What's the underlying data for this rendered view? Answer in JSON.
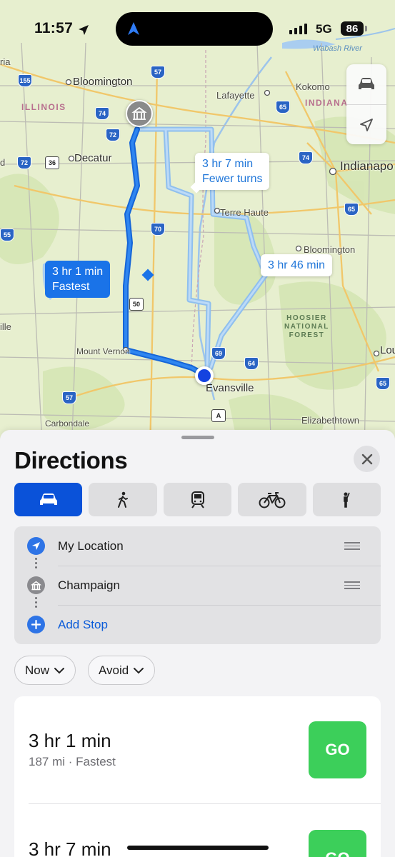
{
  "status_bar": {
    "time": "11:57",
    "network": "5G",
    "battery": "86"
  },
  "map": {
    "cities": [
      "Bloomington",
      "Lafayette",
      "Kokomo",
      "Decatur",
      "Indianapo",
      "Terre Haute",
      "Bloomington",
      "Mount Vernon",
      "Evansville",
      "Carbondale",
      "Elizabethtown",
      "Lou",
      "ille",
      "ria",
      "d"
    ],
    "states": [
      "ILLINOIS",
      "INDIANA"
    ],
    "forest": [
      "HOOSIER",
      "NATIONAL",
      "FOREST"
    ],
    "river": "Wabash River",
    "shields": [
      "155",
      "57",
      "74",
      "72",
      "65",
      "72",
      "36",
      "74",
      "65",
      "70",
      "55",
      "50",
      "69",
      "64",
      "57",
      "65",
      "A"
    ],
    "routes": [
      {
        "duration": "3 hr 1 min",
        "tag": "Fastest"
      },
      {
        "duration": "3 hr 7 min",
        "tag": "Fewer turns"
      },
      {
        "duration": "3 hr 46 min",
        "tag": ""
      }
    ]
  },
  "directions": {
    "title": "Directions",
    "stops": [
      {
        "label": "My Location"
      },
      {
        "label": "Champaign"
      },
      {
        "label": "Add Stop"
      }
    ],
    "filters": [
      {
        "label": "Now"
      },
      {
        "label": "Avoid"
      }
    ],
    "route_list": [
      {
        "time": "3 hr 1 min",
        "meta": "187 mi · Fastest",
        "go": "GO"
      },
      {
        "time": "3 hr 7 min",
        "meta": "",
        "go": "GO"
      }
    ],
    "colors": {
      "accent": "#0a52d9",
      "go": "#3ccf5a",
      "route_primary": "#1a73e8",
      "route_alt": "#8fbfee"
    }
  }
}
